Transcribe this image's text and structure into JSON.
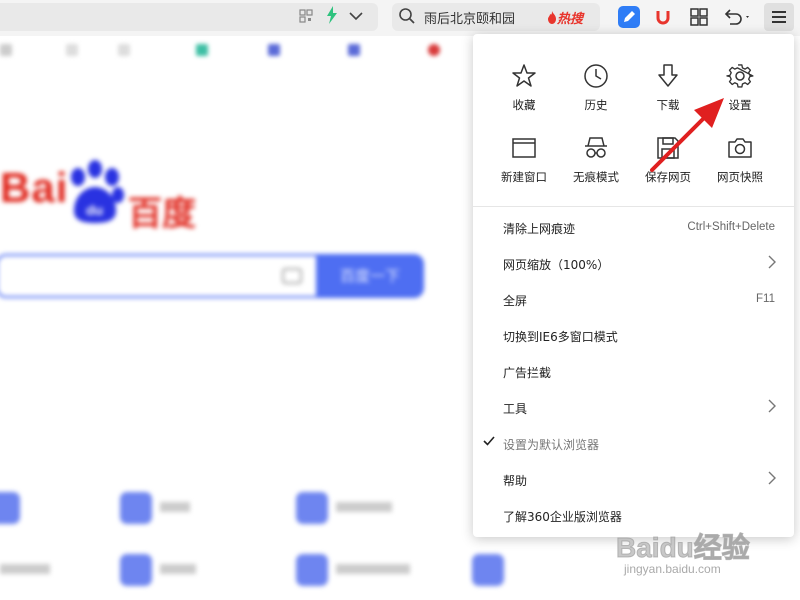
{
  "toolbar": {
    "search_query": "雨后北京颐和园",
    "hot_tag": "热搜",
    "icons": [
      "qr-icon",
      "lightning-icon",
      "chevron-down-icon",
      "search-icon",
      "pen-icon",
      "magnet-icon",
      "grid-icon",
      "undo-icon",
      "menu-icon"
    ]
  },
  "background": {
    "logo_text": "Bai",
    "logo_paw_text": "du",
    "logo_cn": "百度",
    "search_button": "百度一下"
  },
  "menu": {
    "quick_actions": [
      {
        "label": "收藏",
        "icon": "star-icon"
      },
      {
        "label": "历史",
        "icon": "clock-icon"
      },
      {
        "label": "下载",
        "icon": "download-icon"
      },
      {
        "label": "设置",
        "icon": "gear-icon"
      },
      {
        "label": "新建窗口",
        "icon": "window-icon"
      },
      {
        "label": "无痕模式",
        "icon": "incognito-icon"
      },
      {
        "label": "保存网页",
        "icon": "save-icon"
      },
      {
        "label": "网页快照",
        "icon": "camera-icon"
      }
    ],
    "items": [
      {
        "label": "清除上网痕迹",
        "shortcut": "Ctrl+Shift+Delete"
      },
      {
        "label": "网页缩放（100%）",
        "submenu": true
      },
      {
        "label": "全屏",
        "shortcut": "F11"
      },
      {
        "label": "切换到IE6多窗口模式"
      },
      {
        "label": "广告拦截"
      },
      {
        "label": "工具",
        "submenu": true
      },
      {
        "label": "设置为默认浏览器",
        "checked": true
      },
      {
        "label": "帮助",
        "submenu": true
      },
      {
        "label": "了解360企业版浏览器"
      }
    ]
  },
  "watermark": {
    "main": "Baidu经验",
    "sub": "jingyan.baidu.com"
  },
  "colors": {
    "accent_red": "#e8352d",
    "baidu_blue": "#4e6ef2",
    "annotation_arrow": "#e02020"
  }
}
